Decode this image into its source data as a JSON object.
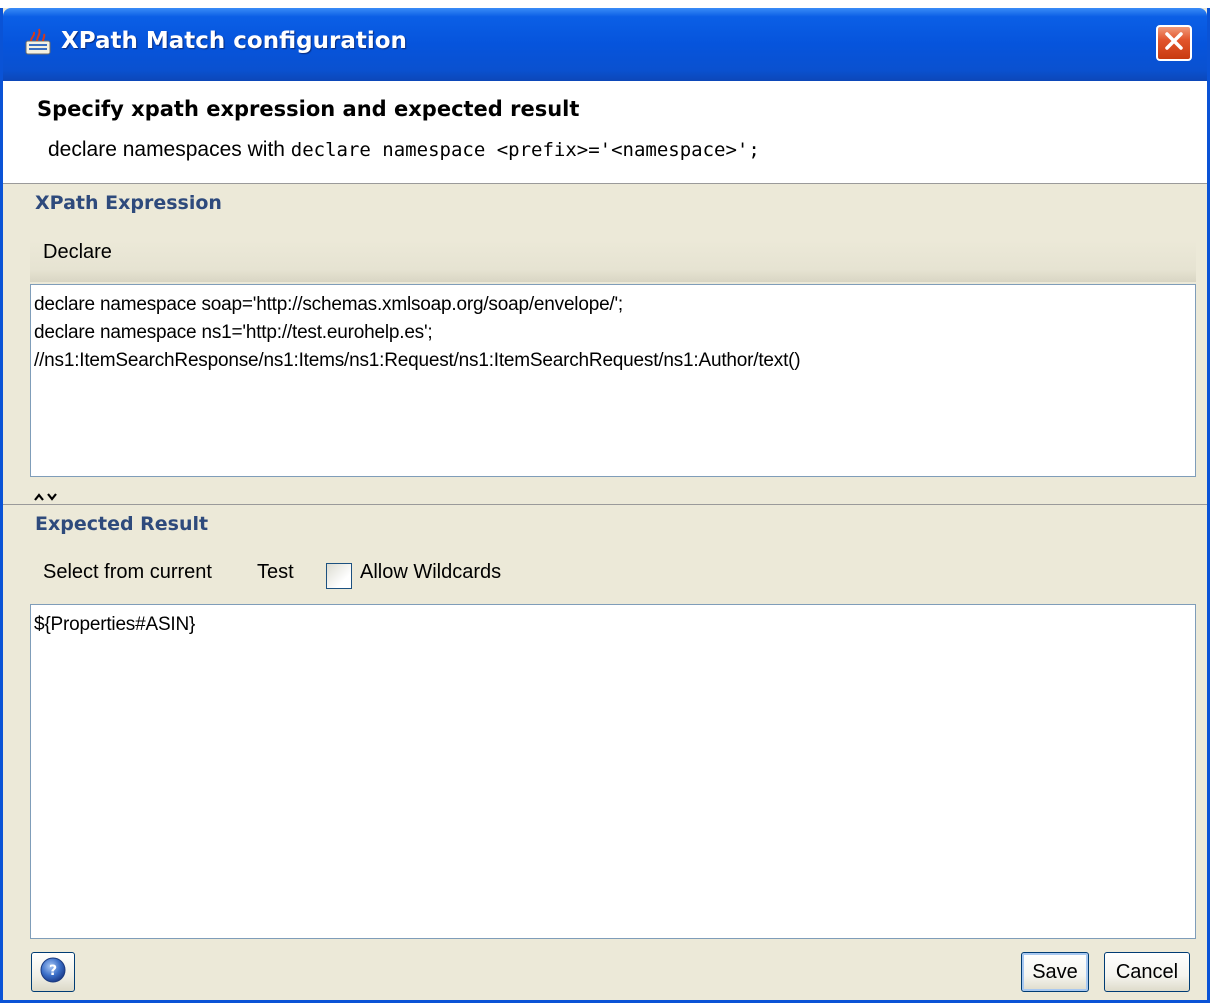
{
  "window": {
    "title": "XPath Match configuration"
  },
  "header": {
    "title": "Specify xpath expression and expected result",
    "desc_prefix": "declare namespaces with ",
    "desc_code": "declare namespace <prefix>='<namespace>';"
  },
  "xpath_section": {
    "label": "XPath Expression",
    "declare_button": "Declare",
    "lines": [
      "declare namespace soap='http://schemas.xmlsoap.org/soap/envelope/';",
      "declare namespace ns1='http://test.eurohelp.es';",
      "//ns1:ItemSearchResponse/ns1:Items/ns1:Request/ns1:ItemSearchRequest/ns1:Author/text()"
    ]
  },
  "expected_section": {
    "label": "Expected Result",
    "select_button": "Select from current",
    "test_button": "Test",
    "wildcards_label": "Allow Wildcards",
    "wildcards_checked": false,
    "value": "${Properties#ASIN}"
  },
  "footer": {
    "save_label": "Save",
    "cancel_label": "Cancel"
  },
  "colors": {
    "titlebar": "#0654dc",
    "section_label": "#2e4a7c",
    "close_button": "#e2552c"
  }
}
